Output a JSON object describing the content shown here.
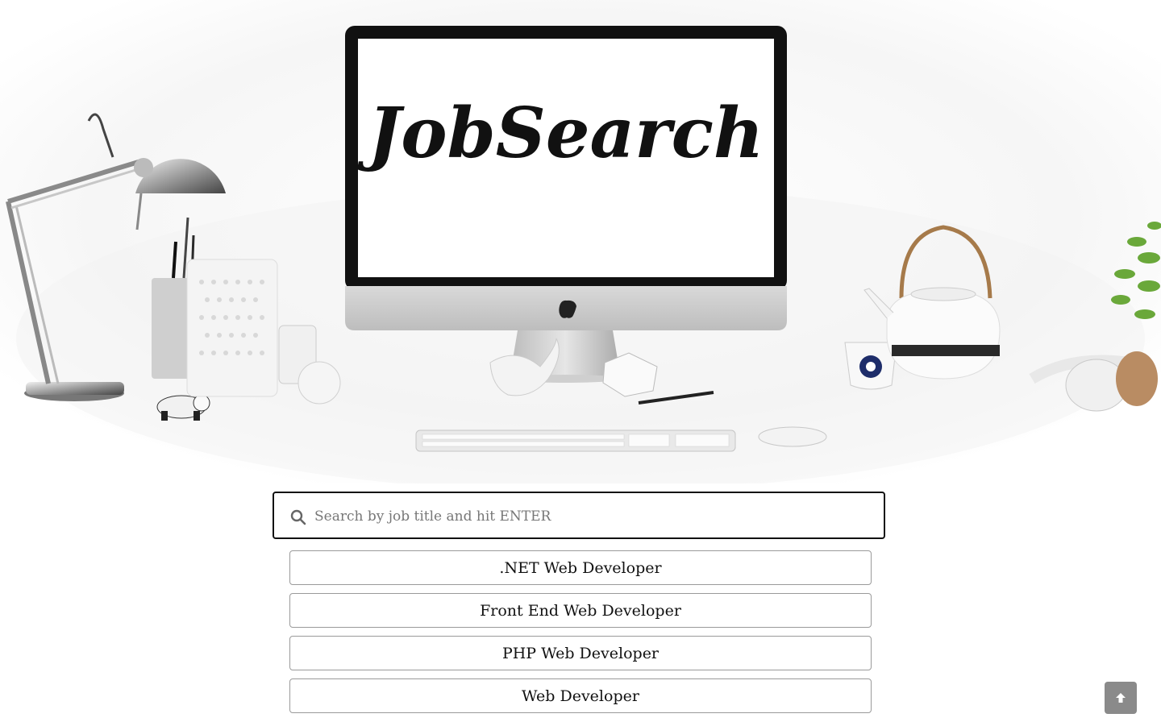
{
  "hero": {
    "logo_text": "JobSearch",
    "image_name": "desk-workspace-scene"
  },
  "search": {
    "placeholder": "Search by job title and hit ENTER",
    "value": "",
    "icon": "search-icon"
  },
  "results": [
    {
      "label": ".NET Web Developer"
    },
    {
      "label": "Front End Web Developer"
    },
    {
      "label": "PHP Web Developer"
    },
    {
      "label": "Web Developer"
    }
  ],
  "scroll_top": {
    "icon": "arrow-up-icon",
    "color": "#8a8a8a"
  },
  "colors": {
    "border": "#111111",
    "result_border": "#9a9a9a",
    "text": "#111111",
    "placeholder": "#777777"
  }
}
